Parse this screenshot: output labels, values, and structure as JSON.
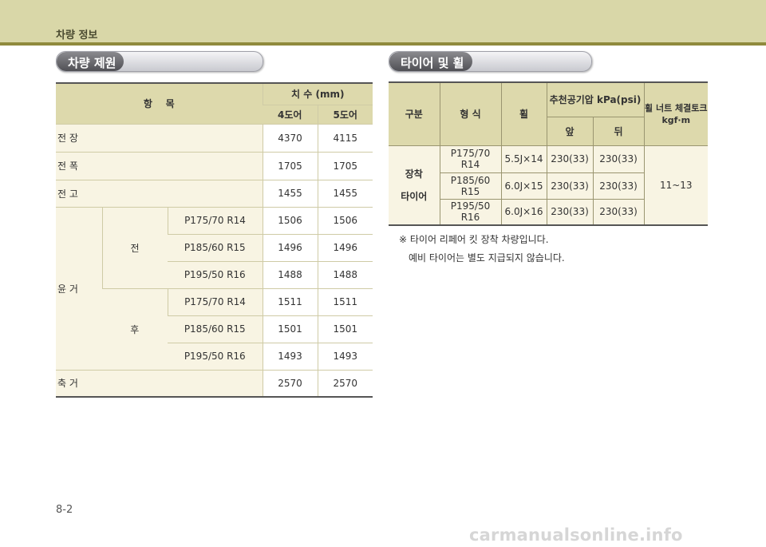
{
  "header": {
    "section_label": "차량 정보"
  },
  "left_section": {
    "title": "차량 제원",
    "table": {
      "col_item": "항    목",
      "col_dim": "치 수 (mm)",
      "col_4door": "4도어",
      "col_5door": "5도어",
      "rows_simple": [
        {
          "label": "전 장",
          "v4": "4370",
          "v5": "4115"
        },
        {
          "label": "전 폭",
          "v4": "1705",
          "v5": "1705"
        },
        {
          "label": "전 고",
          "v4": "1455",
          "v5": "1455"
        }
      ],
      "tread_label": "윤 거",
      "front_label": "전",
      "rear_label": "후",
      "front_rows": [
        {
          "tire": "P175/70 R14",
          "v4": "1506",
          "v5": "1506"
        },
        {
          "tire": "P185/60 R15",
          "v4": "1496",
          "v5": "1496"
        },
        {
          "tire": "P195/50 R16",
          "v4": "1488",
          "v5": "1488"
        }
      ],
      "rear_rows": [
        {
          "tire": "P175/70 R14",
          "v4": "1511",
          "v5": "1511"
        },
        {
          "tire": "P185/60 R15",
          "v4": "1501",
          "v5": "1501"
        },
        {
          "tire": "P195/50 R16",
          "v4": "1493",
          "v5": "1493"
        }
      ],
      "wheelbase": {
        "label": "축 거",
        "v4": "2570",
        "v5": "2570"
      }
    }
  },
  "right_section": {
    "title": "타이어 및 휠",
    "table": {
      "col_category": "구분",
      "col_type": "형 식",
      "col_wheel": "휠",
      "col_pressure": "추천공기압 kPa(psi)",
      "col_front": "앞",
      "col_rear": "뒤",
      "col_torque_line1": "휠 너트 체결토크",
      "col_torque_line2": "kgf·m",
      "category_line1": "장착",
      "category_line2": "타이어",
      "torque_value": "11~13",
      "rows": [
        {
          "type": "P175/70 R14",
          "wheel": "5.5J×14",
          "front": "230(33)",
          "rear": "230(33)"
        },
        {
          "type": "P185/60 R15",
          "wheel": "6.0J×15",
          "front": "230(33)",
          "rear": "230(33)"
        },
        {
          "type": "P195/50 R16",
          "wheel": "6.0J×16",
          "front": "230(33)",
          "rear": "230(33)"
        }
      ]
    },
    "note_line1": "※  타이어 리페어 킷 장착 차량입니다.",
    "note_line2": "예비 타이어는 별도 지급되지 않습니다."
  },
  "footer": {
    "page_number": "8-2",
    "watermark": "carmanualsonline.info"
  }
}
